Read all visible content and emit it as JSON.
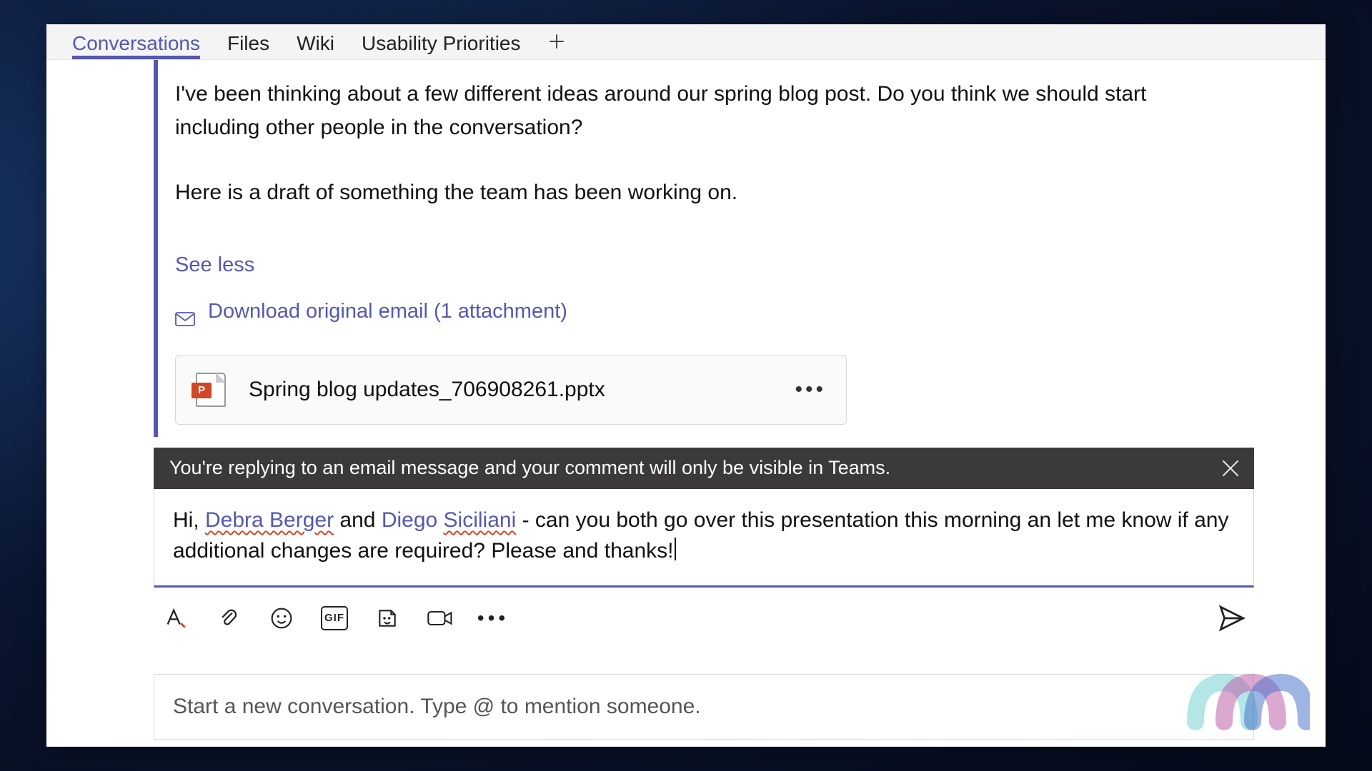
{
  "tabs": {
    "items": [
      {
        "label": "Conversations",
        "active": true
      },
      {
        "label": "Files",
        "active": false
      },
      {
        "label": "Wiki",
        "active": false
      },
      {
        "label": "Usability Priorities",
        "active": false
      }
    ]
  },
  "message": {
    "para1": "I've been thinking about a few different ideas around our spring blog post. Do you think we should start including other people in the conversation?",
    "para2": "Here is a draft of something the team has been working on.",
    "see_less": "See less",
    "download_label": "Download original email (1 attachment)"
  },
  "attachment": {
    "badge": "P",
    "filename": "Spring blog updates_706908261.pptx"
  },
  "notice": {
    "text": "You're replying to an email message and your comment will only be visible in Teams."
  },
  "reply": {
    "pre": "Hi, ",
    "mention1": "Debra Berger",
    "between": " and ",
    "mention2_a": "Diego ",
    "mention2_b": "Siciliani",
    "post": " - can you both go over this presentation this morning an let me know if any additional changes are required?  Please and thanks!"
  },
  "compose": {
    "gif_label": "GIF"
  },
  "newconv": {
    "placeholder": "Start a new conversation. Type @ to mention someone."
  }
}
